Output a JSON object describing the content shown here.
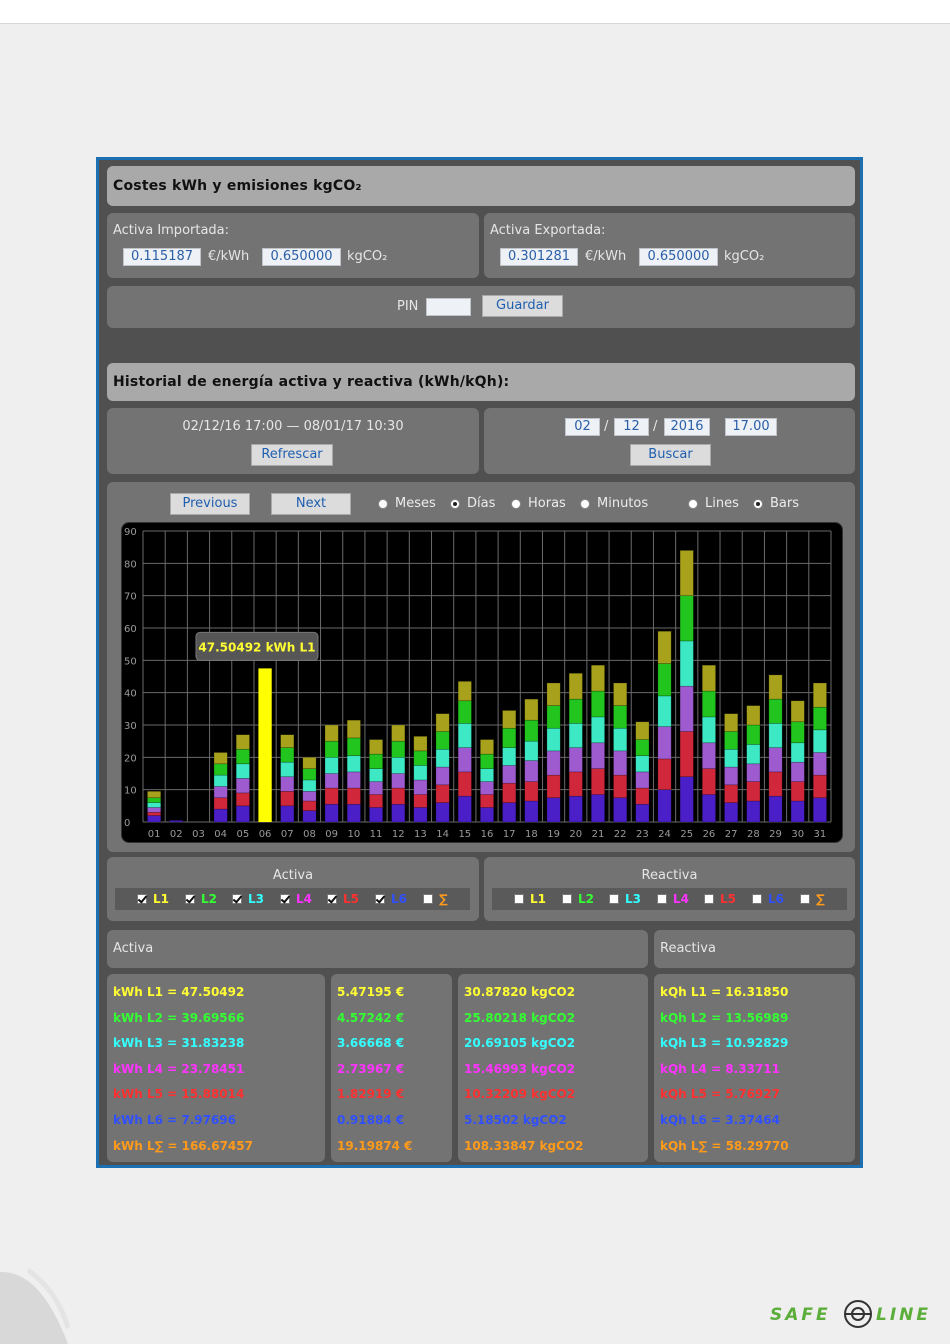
{
  "costs": {
    "title": "Costes kWh y emisiones kgCO₂",
    "imported": {
      "label": "Activa Importada:",
      "price": "0.115187",
      "price_unit": "€/kWh",
      "co2": "0.650000",
      "co2_unit": "kgCO₂"
    },
    "exported": {
      "label": "Activa Exportada:",
      "price": "0.301281",
      "price_unit": "€/kWh",
      "co2": "0.650000",
      "co2_unit": "kgCO₂"
    },
    "pin_label": "PIN",
    "pin_value": "",
    "save_label": "Guardar"
  },
  "history": {
    "title": "Historial de energía activa y reactiva (kWh/kQh):",
    "range_text": "02/12/16 17:00 — 08/01/17 10:30",
    "refresh_label": "Refrescar",
    "date": {
      "day": "02",
      "sep1": "/",
      "month": "12",
      "sep2": "/",
      "year": "2016",
      "time": "17.00"
    },
    "search_label": "Buscar",
    "prev_label": "Previous",
    "next_label": "Next",
    "period_options": [
      {
        "label": "Meses",
        "selected": false
      },
      {
        "label": "Días",
        "selected": true
      },
      {
        "label": "Horas",
        "selected": false
      },
      {
        "label": "Minutos",
        "selected": false
      }
    ],
    "view_options": [
      {
        "label": "Lines",
        "selected": false
      },
      {
        "label": "Bars",
        "selected": true
      }
    ]
  },
  "chart_data": {
    "type": "bar",
    "stacked": true,
    "grid": true,
    "ylim": [
      0,
      90
    ],
    "yticks": [
      "0",
      "10",
      "20",
      "30",
      "40",
      "50",
      "60",
      "70",
      "80",
      "90"
    ],
    "categories": [
      "01",
      "02",
      "03",
      "04",
      "05",
      "06",
      "07",
      "08",
      "09",
      "10",
      "11",
      "12",
      "13",
      "14",
      "15",
      "16",
      "17",
      "18",
      "19",
      "20",
      "21",
      "22",
      "23",
      "24",
      "25",
      "26",
      "27",
      "28",
      "29",
      "30",
      "31"
    ],
    "highlight": {
      "index": 5,
      "value": 47.50492,
      "tooltip": "47.50492 kWh L1",
      "color": "#ffff00"
    },
    "series": [
      {
        "color": "#4b1fc8",
        "values": [
          2,
          0.5,
          0,
          4,
          5,
          0,
          5,
          3.5,
          5.5,
          5.5,
          4.5,
          5.5,
          4.5,
          6,
          8,
          4.5,
          6,
          6.5,
          7.5,
          8,
          8.5,
          7.5,
          5.5,
          10,
          14,
          8.5,
          6,
          6.5,
          8,
          6.5,
          7.5
        ]
      },
      {
        "color": "#d0283a",
        "values": [
          1,
          0,
          0,
          3.5,
          4,
          0,
          4.5,
          3,
          5,
          5,
          4,
          5,
          4,
          5.5,
          7.5,
          4,
          6,
          6,
          7,
          7.5,
          8,
          7,
          5,
          9.5,
          14,
          8,
          5.5,
          6,
          7.5,
          6,
          7
        ]
      },
      {
        "color": "#9e5bd0",
        "values": [
          1.5,
          0,
          0,
          3.5,
          4.5,
          0,
          4.5,
          3,
          4.5,
          5,
          4,
          4.5,
          4.5,
          5.5,
          7.5,
          4,
          5.5,
          6.5,
          7.5,
          7.5,
          8,
          7.5,
          5,
          10,
          14,
          8,
          5.5,
          5.5,
          7.5,
          6,
          7
        ]
      },
      {
        "color": "#3de8c4",
        "values": [
          1.5,
          0,
          0,
          3.5,
          4.5,
          0,
          4.5,
          3.5,
          5,
          5,
          4,
          5,
          4.5,
          5.5,
          7.5,
          4,
          5.5,
          6,
          7,
          7.5,
          8,
          7,
          5,
          9.5,
          14,
          8,
          5.5,
          6,
          7.5,
          6,
          7
        ]
      },
      {
        "color": "#22c41e",
        "values": [
          1.5,
          0,
          0,
          3.5,
          4.5,
          0,
          4.5,
          3.5,
          5,
          5.5,
          4.5,
          5,
          4.5,
          5.5,
          7,
          4.5,
          6,
          6.5,
          7,
          7.5,
          8,
          7,
          5,
          10,
          14,
          8,
          5.5,
          6,
          7.5,
          6.5,
          7
        ]
      },
      {
        "color": "#a8a11c",
        "values": [
          2,
          0,
          0,
          3.5,
          4.5,
          0,
          4,
          3.5,
          5,
          5.5,
          4.5,
          5,
          4.5,
          5.5,
          6,
          4.5,
          5.5,
          6.5,
          7,
          8,
          8,
          7,
          5.5,
          10,
          14,
          8,
          5.5,
          6,
          7.5,
          6.5,
          7.5
        ]
      }
    ]
  },
  "activa_filter": {
    "title": "Activa",
    "items": [
      {
        "label": "L1",
        "checked": true,
        "color": "#ffff33"
      },
      {
        "label": "L2",
        "checked": true,
        "color": "#33ff33"
      },
      {
        "label": "L3",
        "checked": true,
        "color": "#33ffff"
      },
      {
        "label": "L4",
        "checked": true,
        "color": "#ff33ff"
      },
      {
        "label": "L5",
        "checked": true,
        "color": "#ff3030"
      },
      {
        "label": "L6",
        "checked": true,
        "color": "#3050ff"
      },
      {
        "label": "∑",
        "checked": false,
        "color": "#ff9a1a"
      }
    ]
  },
  "reactiva_filter": {
    "title": "Reactiva",
    "items": [
      {
        "label": "L1",
        "checked": false,
        "color": "#ffff33"
      },
      {
        "label": "L2",
        "checked": false,
        "color": "#33ff33"
      },
      {
        "label": "L3",
        "checked": false,
        "color": "#33ffff"
      },
      {
        "label": "L4",
        "checked": false,
        "color": "#ff33ff"
      },
      {
        "label": "L5",
        "checked": false,
        "color": "#ff3030"
      },
      {
        "label": "L6",
        "checked": false,
        "color": "#3050ff"
      },
      {
        "label": "∑",
        "checked": false,
        "color": "#ff9a1a"
      }
    ]
  },
  "summary": {
    "activa_title": "Activa",
    "reactiva_title": "Reactiva",
    "colors": [
      "#ffff33",
      "#33ff33",
      "#33ffff",
      "#ff33ff",
      "#ff3030",
      "#3050ff",
      "#ff9a1a"
    ],
    "kwh": [
      "kWh L1 = 47.50492",
      "kWh L2 = 39.69566",
      "kWh L3 = 31.83238",
      "kWh L4 = 23.78451",
      "kWh L5 = 15.88014",
      "kWh L6 = 7.97696",
      "kWh L∑ = 166.67457"
    ],
    "euros": [
      "5.47195 €",
      "4.57242 €",
      "3.66668 €",
      "2.73967 €",
      "1.82919 €",
      "0.91884 €",
      "19.19874 €"
    ],
    "co2": [
      "30.87820 kgCO2",
      "25.80218 kgCO2",
      "20.69105 kgCO2",
      "15.46993 kgCO2",
      "10.32209 kgCO2",
      "5.18502 kgCO2",
      "108.33847 kgCO2"
    ],
    "kqh": [
      "kQh L1 = 16.31850",
      "kQh L2 = 13.56989",
      "kQh L3 = 10.92829",
      "kQh L4 = 8.33711",
      "kQh L5 = 5.76927",
      "kQh L6 = 3.37464",
      "kQh L∑ = 58.29770"
    ]
  },
  "brand": {
    "left": "SAFE",
    "right": "LINE",
    "color": "#5cae3b"
  }
}
